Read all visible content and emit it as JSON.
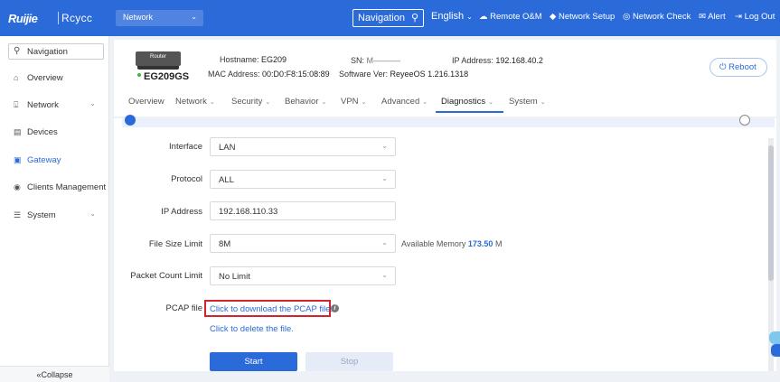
{
  "topbar": {
    "brand": "Ruijie",
    "brand2": "Rcycc",
    "network_select": "Network",
    "navigation": "Navigation",
    "language": "English",
    "remote": "Remote O&M",
    "network_setup": "Network Setup",
    "network_check": "Network Check",
    "alert": "Alert",
    "logout": "Log Out",
    "color": "#2b6ad9"
  },
  "sidebar": {
    "search": "Navigation",
    "items": [
      {
        "label": "Overview",
        "icon": "home-icon"
      },
      {
        "label": "Network",
        "icon": "network-icon"
      },
      {
        "label": "Devices",
        "icon": "devices-icon"
      },
      {
        "label": "Gateway",
        "icon": "gateway-icon"
      },
      {
        "label": "Clients Management",
        "icon": "clients-icon"
      },
      {
        "label": "System",
        "icon": "system-icon"
      }
    ],
    "collapse": "Collapse"
  },
  "device": {
    "router_label": "Router",
    "model": "EG209GS",
    "hostname_label": "Hostname:",
    "hostname": "EG209",
    "mac_label": "MAC Address:",
    "mac": "00:D0:F8:15:08:89",
    "sn_label": "SN:",
    "sn": "M––––––",
    "software_label": "Software Ver:",
    "software": "ReyeeOS 1.216.1318",
    "ip_label": "IP Address:",
    "ip": "192.168.40.2",
    "reboot": "Reboot"
  },
  "tabs": [
    {
      "label": "Overview"
    },
    {
      "label": "Network"
    },
    {
      "label": "Security"
    },
    {
      "label": "Behavior"
    },
    {
      "label": "VPN"
    },
    {
      "label": "Advanced"
    },
    {
      "label": "Diagnostics"
    },
    {
      "label": "System"
    }
  ],
  "form": {
    "interface_label": "Interface",
    "interface_value": "LAN",
    "protocol_label": "Protocol",
    "protocol_value": "ALL",
    "ip_label": "IP Address",
    "ip_value": "192.168.110.33",
    "size_label": "File Size Limit",
    "size_value": "8M",
    "avail_label": "Available Memory",
    "avail_value": "173.50",
    "avail_unit": "M",
    "count_label": "Packet Count Limit",
    "count_value": "No Limit",
    "pcap_label": "PCAP file",
    "pcap_link": "Click to download the PCAP file.",
    "delete_link": "Click to delete the file.",
    "start": "Start",
    "stop": "Stop"
  }
}
